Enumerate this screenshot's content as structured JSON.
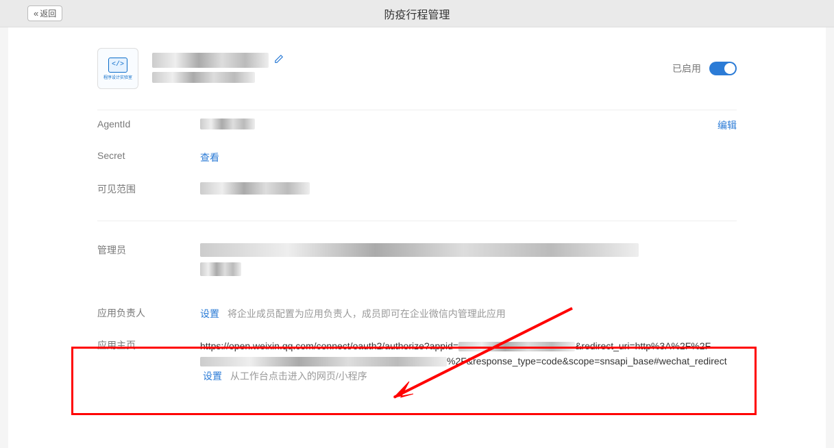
{
  "topbar": {
    "back_label": "返回",
    "title": "防疫行程管理"
  },
  "header": {
    "icon_text": "程序设计实验室",
    "status_label": "已启用"
  },
  "fields": {
    "agentid_label": "AgentId",
    "secret_label": "Secret",
    "secret_action": "查看",
    "scope_label": "可见范围",
    "edit_action": "编辑"
  },
  "admin": {
    "label": "管理员"
  },
  "owner": {
    "label": "应用负责人",
    "action": "设置",
    "hint": "将企业成员配置为应用负责人，成员即可在企业微信内管理此应用"
  },
  "homepage": {
    "label": "应用主页",
    "url_part1": "https://open.weixin.qq.com/connect/oauth2/authorize?appid=",
    "url_part2": "&redirect_uri=http%3A%2F%2F",
    "url_part3": "%2F&response_type=code&scope=snsapi_base#wechat_redirect",
    "action": "设置",
    "hint": "从工作台点击进入的网页/小程序"
  }
}
